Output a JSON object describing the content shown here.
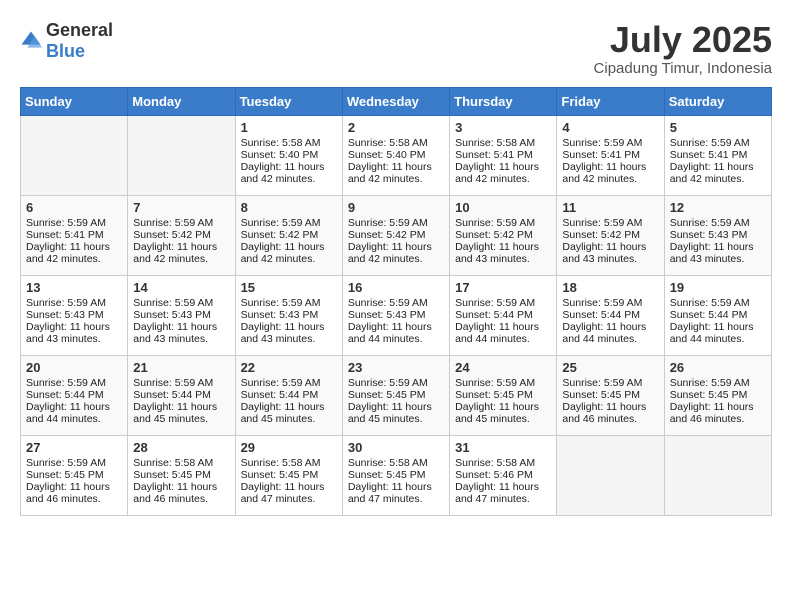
{
  "header": {
    "logo_general": "General",
    "logo_blue": "Blue",
    "month_year": "July 2025",
    "location": "Cipadung Timur, Indonesia"
  },
  "days_of_week": [
    "Sunday",
    "Monday",
    "Tuesday",
    "Wednesday",
    "Thursday",
    "Friday",
    "Saturday"
  ],
  "weeks": [
    [
      {
        "day": "",
        "empty": true
      },
      {
        "day": "",
        "empty": true
      },
      {
        "day": "1",
        "sunrise": "5:58 AM",
        "sunset": "5:40 PM",
        "daylight": "11 hours and 42 minutes."
      },
      {
        "day": "2",
        "sunrise": "5:58 AM",
        "sunset": "5:40 PM",
        "daylight": "11 hours and 42 minutes."
      },
      {
        "day": "3",
        "sunrise": "5:58 AM",
        "sunset": "5:41 PM",
        "daylight": "11 hours and 42 minutes."
      },
      {
        "day": "4",
        "sunrise": "5:59 AM",
        "sunset": "5:41 PM",
        "daylight": "11 hours and 42 minutes."
      },
      {
        "day": "5",
        "sunrise": "5:59 AM",
        "sunset": "5:41 PM",
        "daylight": "11 hours and 42 minutes."
      }
    ],
    [
      {
        "day": "6",
        "sunrise": "5:59 AM",
        "sunset": "5:41 PM",
        "daylight": "11 hours and 42 minutes."
      },
      {
        "day": "7",
        "sunrise": "5:59 AM",
        "sunset": "5:42 PM",
        "daylight": "11 hours and 42 minutes."
      },
      {
        "day": "8",
        "sunrise": "5:59 AM",
        "sunset": "5:42 PM",
        "daylight": "11 hours and 42 minutes."
      },
      {
        "day": "9",
        "sunrise": "5:59 AM",
        "sunset": "5:42 PM",
        "daylight": "11 hours and 42 minutes."
      },
      {
        "day": "10",
        "sunrise": "5:59 AM",
        "sunset": "5:42 PM",
        "daylight": "11 hours and 43 minutes."
      },
      {
        "day": "11",
        "sunrise": "5:59 AM",
        "sunset": "5:42 PM",
        "daylight": "11 hours and 43 minutes."
      },
      {
        "day": "12",
        "sunrise": "5:59 AM",
        "sunset": "5:43 PM",
        "daylight": "11 hours and 43 minutes."
      }
    ],
    [
      {
        "day": "13",
        "sunrise": "5:59 AM",
        "sunset": "5:43 PM",
        "daylight": "11 hours and 43 minutes."
      },
      {
        "day": "14",
        "sunrise": "5:59 AM",
        "sunset": "5:43 PM",
        "daylight": "11 hours and 43 minutes."
      },
      {
        "day": "15",
        "sunrise": "5:59 AM",
        "sunset": "5:43 PM",
        "daylight": "11 hours and 43 minutes."
      },
      {
        "day": "16",
        "sunrise": "5:59 AM",
        "sunset": "5:43 PM",
        "daylight": "11 hours and 44 minutes."
      },
      {
        "day": "17",
        "sunrise": "5:59 AM",
        "sunset": "5:44 PM",
        "daylight": "11 hours and 44 minutes."
      },
      {
        "day": "18",
        "sunrise": "5:59 AM",
        "sunset": "5:44 PM",
        "daylight": "11 hours and 44 minutes."
      },
      {
        "day": "19",
        "sunrise": "5:59 AM",
        "sunset": "5:44 PM",
        "daylight": "11 hours and 44 minutes."
      }
    ],
    [
      {
        "day": "20",
        "sunrise": "5:59 AM",
        "sunset": "5:44 PM",
        "daylight": "11 hours and 44 minutes."
      },
      {
        "day": "21",
        "sunrise": "5:59 AM",
        "sunset": "5:44 PM",
        "daylight": "11 hours and 45 minutes."
      },
      {
        "day": "22",
        "sunrise": "5:59 AM",
        "sunset": "5:44 PM",
        "daylight": "11 hours and 45 minutes."
      },
      {
        "day": "23",
        "sunrise": "5:59 AM",
        "sunset": "5:45 PM",
        "daylight": "11 hours and 45 minutes."
      },
      {
        "day": "24",
        "sunrise": "5:59 AM",
        "sunset": "5:45 PM",
        "daylight": "11 hours and 45 minutes."
      },
      {
        "day": "25",
        "sunrise": "5:59 AM",
        "sunset": "5:45 PM",
        "daylight": "11 hours and 46 minutes."
      },
      {
        "day": "26",
        "sunrise": "5:59 AM",
        "sunset": "5:45 PM",
        "daylight": "11 hours and 46 minutes."
      }
    ],
    [
      {
        "day": "27",
        "sunrise": "5:59 AM",
        "sunset": "5:45 PM",
        "daylight": "11 hours and 46 minutes."
      },
      {
        "day": "28",
        "sunrise": "5:58 AM",
        "sunset": "5:45 PM",
        "daylight": "11 hours and 46 minutes."
      },
      {
        "day": "29",
        "sunrise": "5:58 AM",
        "sunset": "5:45 PM",
        "daylight": "11 hours and 47 minutes."
      },
      {
        "day": "30",
        "sunrise": "5:58 AM",
        "sunset": "5:45 PM",
        "daylight": "11 hours and 47 minutes."
      },
      {
        "day": "31",
        "sunrise": "5:58 AM",
        "sunset": "5:46 PM",
        "daylight": "11 hours and 47 minutes."
      },
      {
        "day": "",
        "empty": true
      },
      {
        "day": "",
        "empty": true
      }
    ]
  ],
  "labels": {
    "sunrise_prefix": "Sunrise: ",
    "sunset_prefix": "Sunset: ",
    "daylight_prefix": "Daylight: "
  }
}
